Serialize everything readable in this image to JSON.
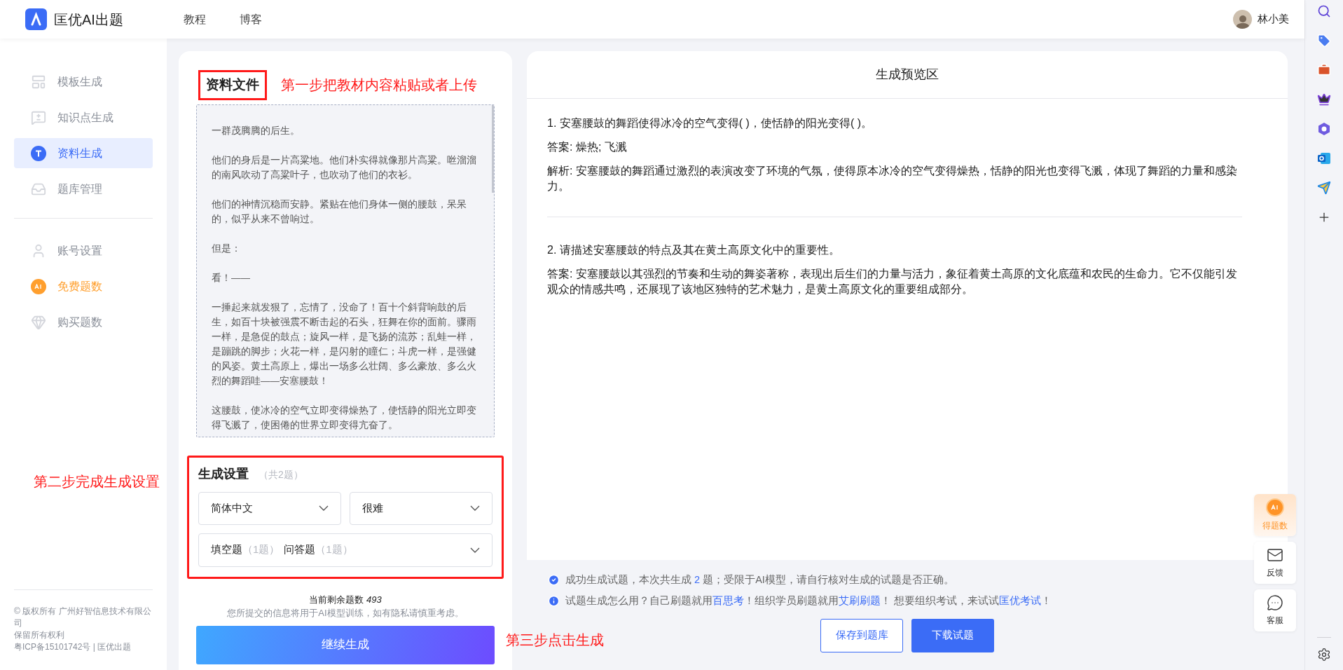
{
  "header": {
    "logo_text": "匡优AI出题",
    "nav": [
      {
        "label": "教程"
      },
      {
        "label": "博客"
      }
    ],
    "user": "林小美"
  },
  "sidebar": {
    "groups": [
      [
        {
          "label": "模板生成",
          "kind": "template",
          "selected": false
        },
        {
          "label": "知识点生成",
          "kind": "knowledge",
          "selected": false
        },
        {
          "label": "资料生成",
          "kind": "material",
          "selected": true
        },
        {
          "label": "题库管理",
          "kind": "bank",
          "selected": false
        }
      ],
      [
        {
          "label": "账号设置",
          "kind": "account",
          "selected": false
        },
        {
          "label": "免费题数",
          "kind": "free",
          "selected": false
        },
        {
          "label": "购买题数",
          "kind": "buy",
          "selected": false
        }
      ]
    ],
    "footer": [
      "© 版权所有 广州好智信息技术有限公司",
      "保留所有权利",
      "粤ICP备15101742号 | 匡优出题"
    ]
  },
  "annotations": [
    "第一步把教材内容粘贴或者上传",
    "第二步完成生成设置",
    "第三步点击生成"
  ],
  "material": {
    "title": "资料文件",
    "paragraphs": [
      "一群茂腾腾的后生。",
      "他们的身后是一片高粱地。他们朴实得就像那片高粱。咝溜溜的南风吹动了高粱叶子，也吹动了他们的衣衫。",
      "他们的神情沉稳而安静。紧贴在他们身体一侧的腰鼓，呆呆的，似乎从来不曾响过。",
      "但是：",
      "看！——",
      "一捶起来就发狠了，忘情了，没命了！百十个斜背响鼓的后生，如百十块被强震不断击起的石头，狂舞在你的面前。骤雨一样，是急促的鼓点；旋风一样，是飞扬的流苏；乱蛙一样，是蹦跳的脚步；火花一样，是闪射的瞳仁；斗虎一样，是强健的风姿。黄土高原上，爆出一场多么壮阔、多么豪放、多么火烈的舞蹈哇——安塞腰鼓！",
      "这腰鼓，使冰冷的空气立即变得燥热了，使恬静的阳光立即变得飞溅了，使困倦的世界立即变得亢奋了。"
    ]
  },
  "settings": {
    "title": "生成设置",
    "total": "（共2题）",
    "language": "简体中文",
    "difficulty": "很难",
    "types": [
      {
        "name": "填空题",
        "count": "（1题）"
      },
      {
        "name": "问答题",
        "count": "（1题）"
      }
    ]
  },
  "remaining": {
    "label": "当前剩余题数",
    "value": "493",
    "notice": "您所提交的信息将用于AI模型训练，如有隐私请慎重考虑。"
  },
  "generate_button": "继续生成",
  "preview": {
    "title": "生成预览区",
    "questions": [
      {
        "question": "1. 安塞腰鼓的舞蹈使得冰冷的空气变得( )，使恬静的阳光变得( )。",
        "answer": "答案: 燥热; 飞溅",
        "analysis": "解析: 安塞腰鼓的舞蹈通过激烈的表演改变了环境的气氛，使得原本冰冷的空气变得燥热，恬静的阳光也变得飞溅，体现了舞蹈的力量和感染力。"
      },
      {
        "question": "2. 请描述安塞腰鼓的特点及其在黄土高原文化中的重要性。",
        "answer": "答案: 安塞腰鼓以其强烈的节奏和生动的舞姿著称，表现出后生们的力量与活力，象征着黄土高原的文化底蕴和农民的生命力。它不仅能引发观众的情感共鸣，还展现了该地区独特的艺术魅力，是黄土高原文化的重要组成部分。"
      }
    ]
  },
  "messages": [
    {
      "kind": "success",
      "parts": [
        {
          "kind": "text",
          "text": "成功生成试题，本次共生成 "
        },
        {
          "kind": "number",
          "text": "2"
        },
        {
          "kind": "text",
          "text": " 题；受限于AI模型，请自行核对生成的试题是否正确。"
        }
      ]
    },
    {
      "kind": "info",
      "parts": [
        {
          "kind": "text",
          "text": "试题生成怎么用？自己刷题就用"
        },
        {
          "kind": "link",
          "text": "百思考"
        },
        {
          "kind": "text",
          "text": "！组织学员刷题就用"
        },
        {
          "kind": "link",
          "text": "艾刷刷题"
        },
        {
          "kind": "text",
          "text": "！ 想要组织考试，来试试"
        },
        {
          "kind": "link",
          "text": "匡优考试"
        },
        {
          "kind": "text",
          "text": "！"
        }
      ]
    }
  ],
  "actions": [
    {
      "label": "保存到题库",
      "kind": "outline"
    },
    {
      "label": "下载试题",
      "kind": "primary"
    }
  ],
  "widgets": [
    {
      "label": "得题数",
      "kind": "credits"
    },
    {
      "label": "反馈",
      "kind": "feedback"
    },
    {
      "label": "客服",
      "kind": "service"
    }
  ]
}
